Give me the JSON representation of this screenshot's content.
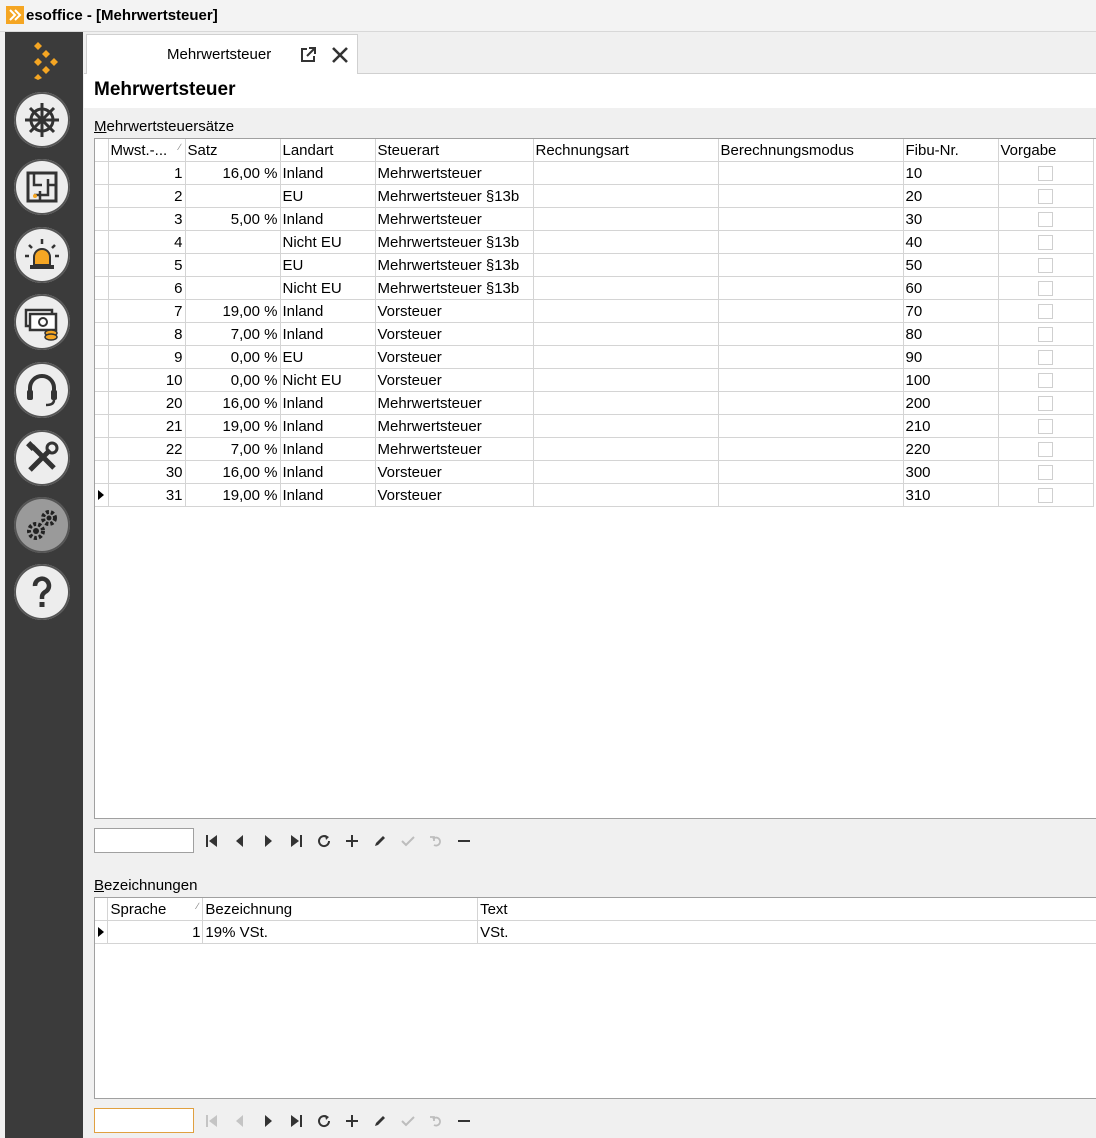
{
  "window": {
    "title": "esoffice - [Mehrwertsteuer]"
  },
  "sidebar": {
    "items": [
      {
        "name": "navigation",
        "icon": "ship-wheel-icon"
      },
      {
        "name": "maze",
        "icon": "maze-icon"
      },
      {
        "name": "alarm",
        "icon": "alarm-light-icon"
      },
      {
        "name": "finance",
        "icon": "money-coins-icon"
      },
      {
        "name": "support",
        "icon": "headset-icon"
      },
      {
        "name": "tools",
        "icon": "tools-icon"
      },
      {
        "name": "settings",
        "icon": "gears-icon",
        "active": true
      },
      {
        "name": "help",
        "icon": "help-icon"
      }
    ]
  },
  "tab": {
    "label": "Mehrwertsteuer"
  },
  "page": {
    "title": "Mehrwertsteuer"
  },
  "rates": {
    "section_label_first": "M",
    "section_label_rest": "ehrwertsteuersätze",
    "columns": [
      "Mwst.-...",
      "Satz",
      "Landart",
      "Steuerart",
      "Rechnungsart",
      "Berechnungsmodus",
      "Fibu-Nr.",
      "Vorgabe"
    ],
    "rows": [
      {
        "nr": "1",
        "satz": "16,00 %",
        "landart": "Inland",
        "steuerart": "Mehrwertsteuer",
        "rechnungsart": "",
        "modus": "",
        "fibu": "10",
        "vorgabe": false
      },
      {
        "nr": "2",
        "satz": "",
        "landart": "EU",
        "steuerart": "Mehrwertsteuer §13b",
        "rechnungsart": "",
        "modus": "",
        "fibu": "20",
        "vorgabe": false
      },
      {
        "nr": "3",
        "satz": "5,00 %",
        "landart": "Inland",
        "steuerart": "Mehrwertsteuer",
        "rechnungsart": "",
        "modus": "",
        "fibu": "30",
        "vorgabe": false
      },
      {
        "nr": "4",
        "satz": "",
        "landart": "Nicht EU",
        "steuerart": "Mehrwertsteuer §13b",
        "rechnungsart": "",
        "modus": "",
        "fibu": "40",
        "vorgabe": false
      },
      {
        "nr": "5",
        "satz": "",
        "landart": "EU",
        "steuerart": "Mehrwertsteuer §13b",
        "rechnungsart": "",
        "modus": "",
        "fibu": "50",
        "vorgabe": false
      },
      {
        "nr": "6",
        "satz": "",
        "landart": "Nicht EU",
        "steuerart": "Mehrwertsteuer §13b",
        "rechnungsart": "",
        "modus": "",
        "fibu": "60",
        "vorgabe": false
      },
      {
        "nr": "7",
        "satz": "19,00 %",
        "landart": "Inland",
        "steuerart": "Vorsteuer",
        "rechnungsart": "",
        "modus": "",
        "fibu": "70",
        "vorgabe": false
      },
      {
        "nr": "8",
        "satz": "7,00 %",
        "landart": "Inland",
        "steuerart": "Vorsteuer",
        "rechnungsart": "",
        "modus": "",
        "fibu": "80",
        "vorgabe": false
      },
      {
        "nr": "9",
        "satz": "0,00 %",
        "landart": "EU",
        "steuerart": "Vorsteuer",
        "rechnungsart": "",
        "modus": "",
        "fibu": "90",
        "vorgabe": false
      },
      {
        "nr": "10",
        "satz": "0,00 %",
        "landart": "Nicht EU",
        "steuerart": "Vorsteuer",
        "rechnungsart": "",
        "modus": "",
        "fibu": "100",
        "vorgabe": false
      },
      {
        "nr": "20",
        "satz": "16,00 %",
        "landart": "Inland",
        "steuerart": "Mehrwertsteuer",
        "rechnungsart": "",
        "modus": "",
        "fibu": "200",
        "vorgabe": false
      },
      {
        "nr": "21",
        "satz": "19,00 %",
        "landart": "Inland",
        "steuerart": "Mehrwertsteuer",
        "rechnungsart": "",
        "modus": "",
        "fibu": "210",
        "vorgabe": false
      },
      {
        "nr": "22",
        "satz": "7,00 %",
        "landart": "Inland",
        "steuerart": "Mehrwertsteuer",
        "rechnungsart": "",
        "modus": "",
        "fibu": "220",
        "vorgabe": false
      },
      {
        "nr": "30",
        "satz": "16,00 %",
        "landart": "Inland",
        "steuerart": "Vorsteuer",
        "rechnungsart": "",
        "modus": "",
        "fibu": "300",
        "vorgabe": false
      },
      {
        "nr": "31",
        "satz": "19,00 %",
        "landart": "Inland",
        "steuerart": "Vorsteuer",
        "rechnungsart": "",
        "modus": "",
        "fibu": "310",
        "vorgabe": false,
        "current": true
      }
    ],
    "navigator": {
      "input_value": ""
    }
  },
  "names": {
    "section_label_first": "B",
    "section_label_rest": "ezeichnungen",
    "columns": [
      "Sprache",
      "Bezeichnung",
      "Text"
    ],
    "rows": [
      {
        "sprache": "1",
        "bezeichnung": "19% VSt.",
        "text": "VSt.",
        "current": true
      }
    ],
    "navigator": {
      "input_value": ""
    }
  },
  "navigator_buttons": [
    "first-record",
    "prior-record",
    "next-record",
    "last-record",
    "refresh",
    "insert",
    "edit",
    "post",
    "cancel",
    "delete"
  ],
  "colors": {
    "sidebar": "#3b3b3b",
    "brand_orange": "#f5a623"
  }
}
